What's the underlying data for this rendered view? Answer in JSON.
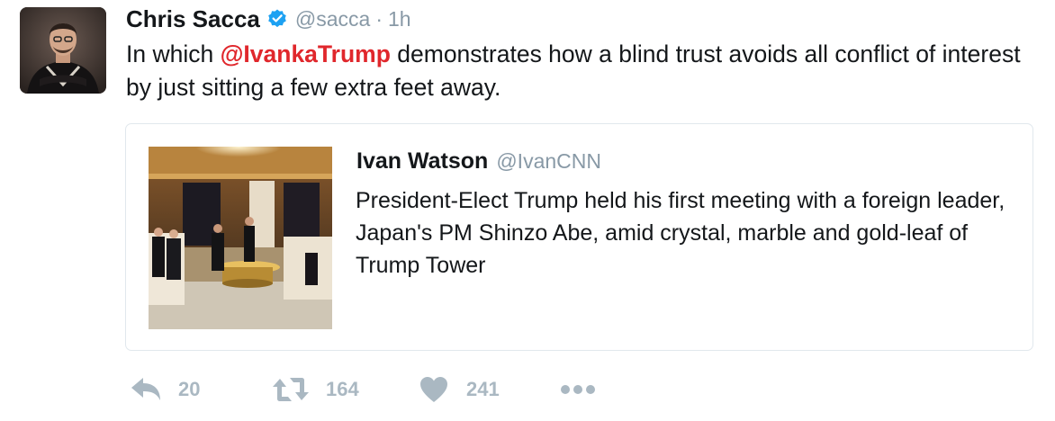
{
  "tweet": {
    "author_name": "Chris Sacca",
    "handle": "@sacca",
    "separator": "·",
    "time": "1h",
    "text_before": "In which ",
    "mention": "@IvankaTrump",
    "text_after": " demonstrates how a blind trust avoids all conflict of interest by just sitting a few extra feet away."
  },
  "quoted": {
    "author_name": "Ivan Watson",
    "handle": "@IvanCNN",
    "text": "President-Elect Trump held his first meeting with a foreign leader, Japan's PM Shinzo Abe, amid crystal, marble and gold-leaf of Trump Tower"
  },
  "actions": {
    "reply_count": "20",
    "retweet_count": "164",
    "like_count": "241"
  },
  "icons": [
    "verified-badge-icon",
    "reply-icon",
    "retweet-icon",
    "heart-icon",
    "more-icon"
  ],
  "colors": {
    "mention": "#e0272c",
    "verified": "#1da1f2",
    "muted": "#8899a6",
    "action": "#aab8c2"
  }
}
